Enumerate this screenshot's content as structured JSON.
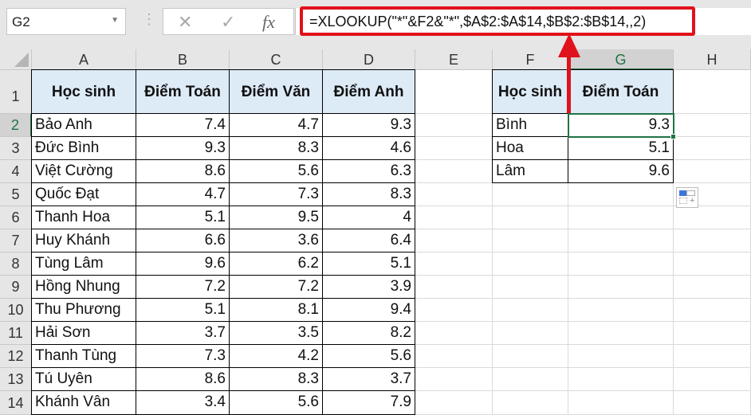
{
  "name_box": "G2",
  "formula_bar": {
    "cancel": "✕",
    "enter": "✓",
    "fx": "fx",
    "formula": "=XLOOKUP(\"*\"&F2&\"*\",$A$2:$A$14,$B$2:$B$14,,2)"
  },
  "columns": [
    "A",
    "B",
    "C",
    "D",
    "E",
    "F",
    "G",
    "H"
  ],
  "rows": [
    "1",
    "2",
    "3",
    "4",
    "5",
    "6",
    "7",
    "8",
    "9",
    "10",
    "11",
    "12",
    "13",
    "14"
  ],
  "table1": {
    "headers": [
      "Học sinh",
      "Điểm Toán",
      "Điểm Văn",
      "Điểm Anh"
    ],
    "data": [
      [
        "Bảo Anh",
        "7.4",
        "4.7",
        "9.3"
      ],
      [
        "Đức Bình",
        "9.3",
        "8.3",
        "4.6"
      ],
      [
        "Việt Cường",
        "8.6",
        "5.6",
        "6.3"
      ],
      [
        "Quốc Đạt",
        "4.7",
        "7.3",
        "8.3"
      ],
      [
        "Thanh Hoa",
        "5.1",
        "9.5",
        "4"
      ],
      [
        "Huy Khánh",
        "6.6",
        "3.6",
        "6.4"
      ],
      [
        "Tùng Lâm",
        "9.6",
        "6.2",
        "5.1"
      ],
      [
        "Hồng Nhung",
        "7.2",
        "7.2",
        "3.9"
      ],
      [
        "Thu Phương",
        "5.1",
        "8.1",
        "9.4"
      ],
      [
        "Hải Sơn",
        "3.7",
        "3.5",
        "8.2"
      ],
      [
        "Thanh Tùng",
        "7.3",
        "4.2",
        "5.6"
      ],
      [
        "Tú Uyên",
        "8.6",
        "8.3",
        "3.7"
      ],
      [
        "Khánh Vân",
        "3.4",
        "5.6",
        "7.9"
      ]
    ]
  },
  "table2": {
    "headers": [
      "Học sinh",
      "Điểm Toán"
    ],
    "data": [
      [
        "Bình",
        "9.3"
      ],
      [
        "Hoa",
        "5.1"
      ],
      [
        "Lâm",
        "9.6"
      ]
    ]
  },
  "colors": {
    "accent": "#217346",
    "highlight": "#e0121b",
    "header_fill": "#ddebf7"
  }
}
